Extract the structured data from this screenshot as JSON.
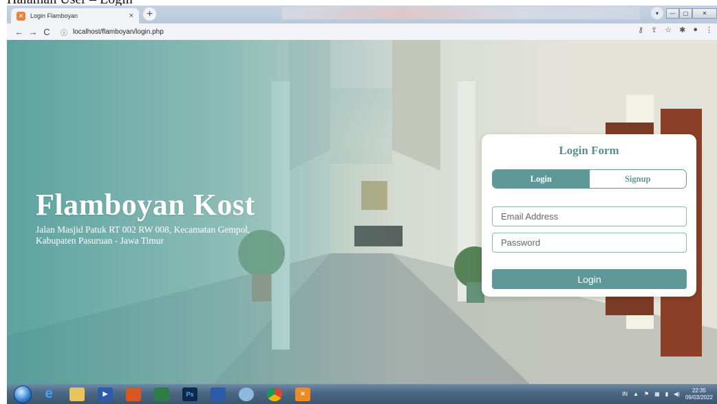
{
  "caption": "Halaman User – Login",
  "browser": {
    "tab_title": "Login Flamboyan",
    "tab_close": "×",
    "new_tab": "+",
    "url": "localhost/flamboyan/login.php",
    "window_controls": [
      "▾",
      "—",
      "▢",
      "✕"
    ]
  },
  "hero": {
    "title": "Flamboyan Kost",
    "address_line1": "Jalan Masjid Patuk RT 002 RW 008, Kecamatan Gempol,",
    "address_line2": "Kabupaten Pasuruan - Jawa Timur"
  },
  "login_form": {
    "title": "Login Form",
    "tab_login": "Login",
    "tab_signup": "Signup",
    "email_placeholder": "Email Address",
    "password_placeholder": "Password",
    "submit_label": "Login"
  },
  "taskbar": {
    "apps": [
      "Ps"
    ],
    "tray_lang": "IN",
    "time": "22:35",
    "date": "09/03/2022"
  },
  "colors": {
    "accent": "#5e9898",
    "title": "#5a8f8f"
  }
}
